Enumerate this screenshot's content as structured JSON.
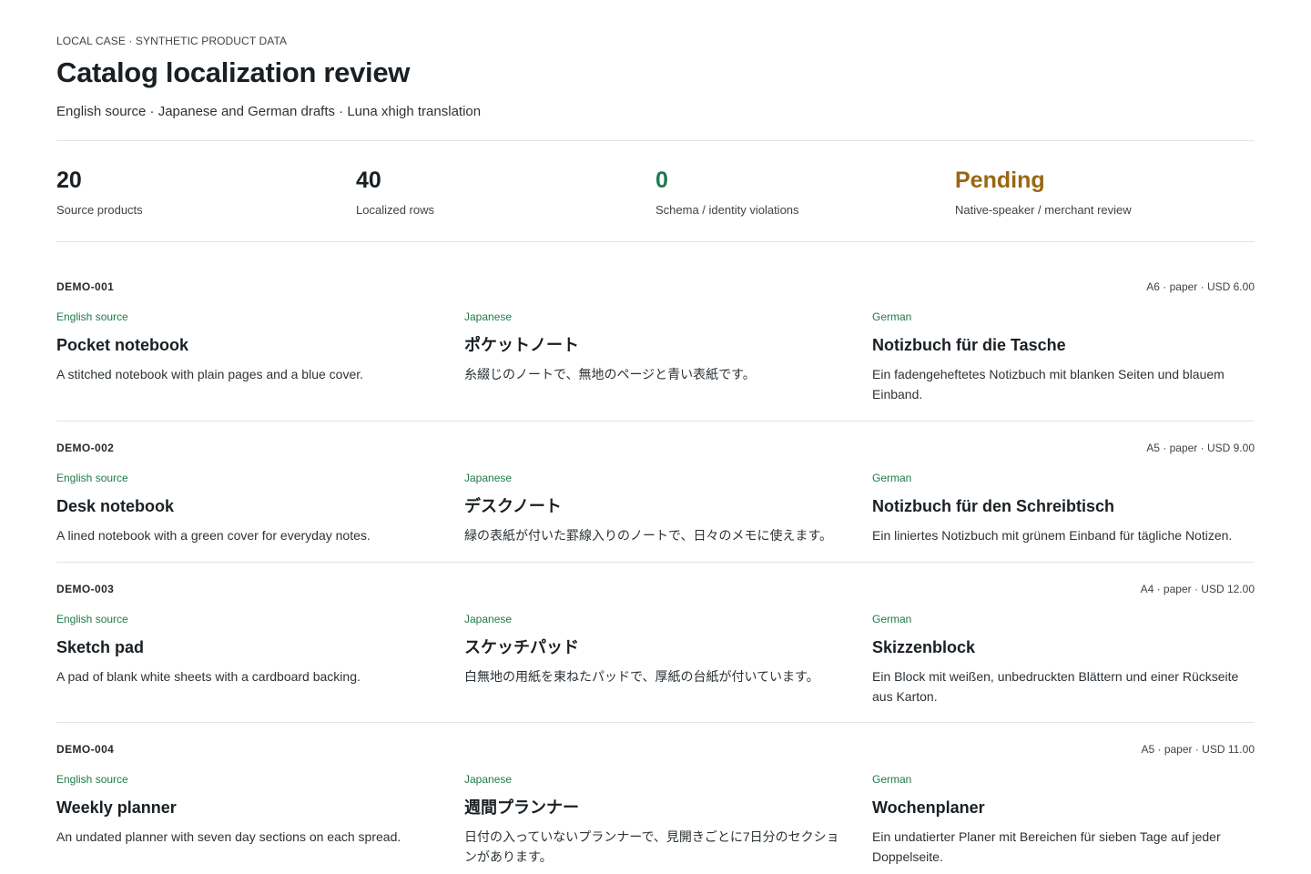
{
  "header": {
    "eyebrow": "LOCAL CASE · SYNTHETIC PRODUCT DATA",
    "title": "Catalog localization review",
    "subtitle": "English source · Japanese and German drafts · Luna xhigh translation"
  },
  "metrics": [
    {
      "value": "20",
      "label": "Source products",
      "color": "#1a1f23"
    },
    {
      "value": "40",
      "label": "Localized rows",
      "color": "#1a1f23"
    },
    {
      "value": "0",
      "label": "Schema / identity violations",
      "color": "#1d7a50"
    },
    {
      "value": "Pending",
      "label": "Native-speaker / merchant review",
      "color": "#9a6612"
    }
  ],
  "colors": {
    "accent_green": "#1f7a4a",
    "pending_amber": "#9a6612"
  },
  "products": [
    {
      "sku": "DEMO-001",
      "meta": "A6 · paper · USD 6.00",
      "translations": [
        {
          "lang": "English source",
          "name": "Pocket notebook",
          "desc": "A stitched notebook with plain pages and a blue cover."
        },
        {
          "lang": "Japanese",
          "name": "ポケットノート",
          "desc": "糸綴じのノートで、無地のページと青い表紙です。"
        },
        {
          "lang": "German",
          "name": "Notizbuch für die Tasche",
          "desc": "Ein fadengeheftetes Notizbuch mit blanken Seiten und blauem Einband."
        }
      ]
    },
    {
      "sku": "DEMO-002",
      "meta": "A5 · paper · USD 9.00",
      "translations": [
        {
          "lang": "English source",
          "name": "Desk notebook",
          "desc": "A lined notebook with a green cover for everyday notes."
        },
        {
          "lang": "Japanese",
          "name": "デスクノート",
          "desc": "緑の表紙が付いた罫線入りのノートで、日々のメモに使えます。"
        },
        {
          "lang": "German",
          "name": "Notizbuch für den Schreibtisch",
          "desc": "Ein liniertes Notizbuch mit grünem Einband für tägliche Notizen."
        }
      ]
    },
    {
      "sku": "DEMO-003",
      "meta": "A4 · paper · USD 12.00",
      "translations": [
        {
          "lang": "English source",
          "name": "Sketch pad",
          "desc": "A pad of blank white sheets with a cardboard backing."
        },
        {
          "lang": "Japanese",
          "name": "スケッチパッド",
          "desc": "白無地の用紙を束ねたパッドで、厚紙の台紙が付いています。"
        },
        {
          "lang": "German",
          "name": "Skizzenblock",
          "desc": "Ein Block mit weißen, unbedruckten Blättern und einer Rückseite aus Karton."
        }
      ]
    },
    {
      "sku": "DEMO-004",
      "meta": "A5 · paper · USD 11.00",
      "translations": [
        {
          "lang": "English source",
          "name": "Weekly planner",
          "desc": "An undated planner with seven day sections on each spread."
        },
        {
          "lang": "Japanese",
          "name": "週間プランナー",
          "desc": "日付の入っていないプランナーで、見開きごとに7日分のセクションがあります。"
        },
        {
          "lang": "German",
          "name": "Wochenplaner",
          "desc": "Ein undatierter Planer mit Bereichen für sieben Tage auf jeder Doppelseite."
        }
      ]
    }
  ]
}
